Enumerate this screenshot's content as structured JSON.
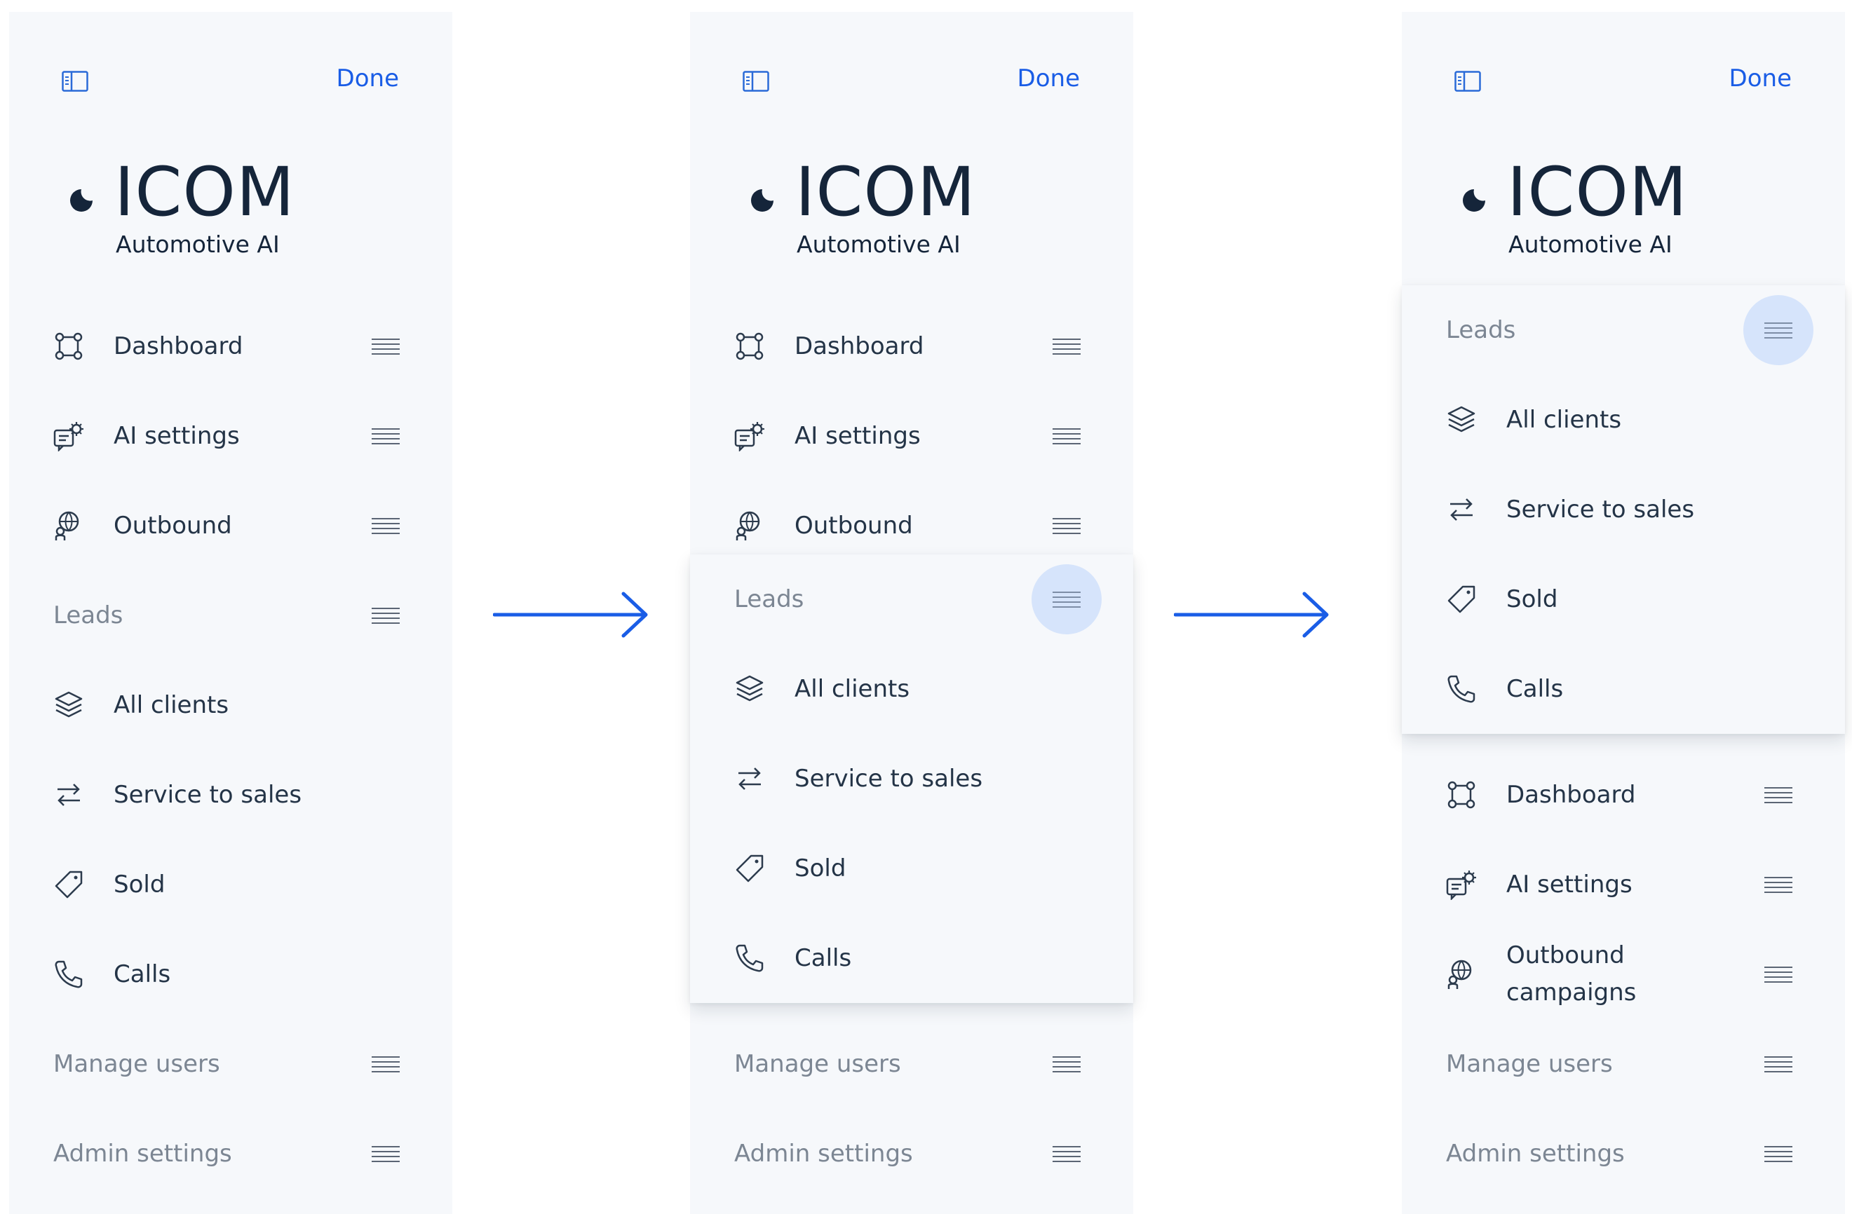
{
  "brand": {
    "name": "ICOM",
    "tagline": "Automotive AI"
  },
  "header": {
    "done_label": "Done"
  },
  "labels": {
    "dashboard": "Dashboard",
    "ai_settings": "AI settings",
    "outbound": "Outbound",
    "outbound_campaigns": "Outbound campaigns",
    "leads": "Leads",
    "all_clients": "All clients",
    "service_to_sales": "Service to sales",
    "sold": "Sold",
    "calls": "Calls",
    "manage_users": "Manage users",
    "admin_settings": "Admin settings"
  },
  "colors": {
    "accent": "#1a5de6",
    "panel_bg": "#f6f8fb",
    "drag_halo": "#d6e4fb",
    "text_primary": "#243447",
    "text_muted": "#7c8693",
    "arrow": "#1a5de6"
  },
  "icons": {
    "sidebar_toggle": "sidebar-toggle-icon",
    "dashboard": "nodes-icon",
    "ai_settings": "chat-gear-icon",
    "outbound": "people-globe-icon",
    "all_clients": "layers-icon",
    "service_to_sales": "swap-arrows-icon",
    "sold": "tag-icon",
    "calls": "phone-icon",
    "drag_handle": "drag-handle-icon",
    "flow_arrow": "arrow-right-icon"
  }
}
